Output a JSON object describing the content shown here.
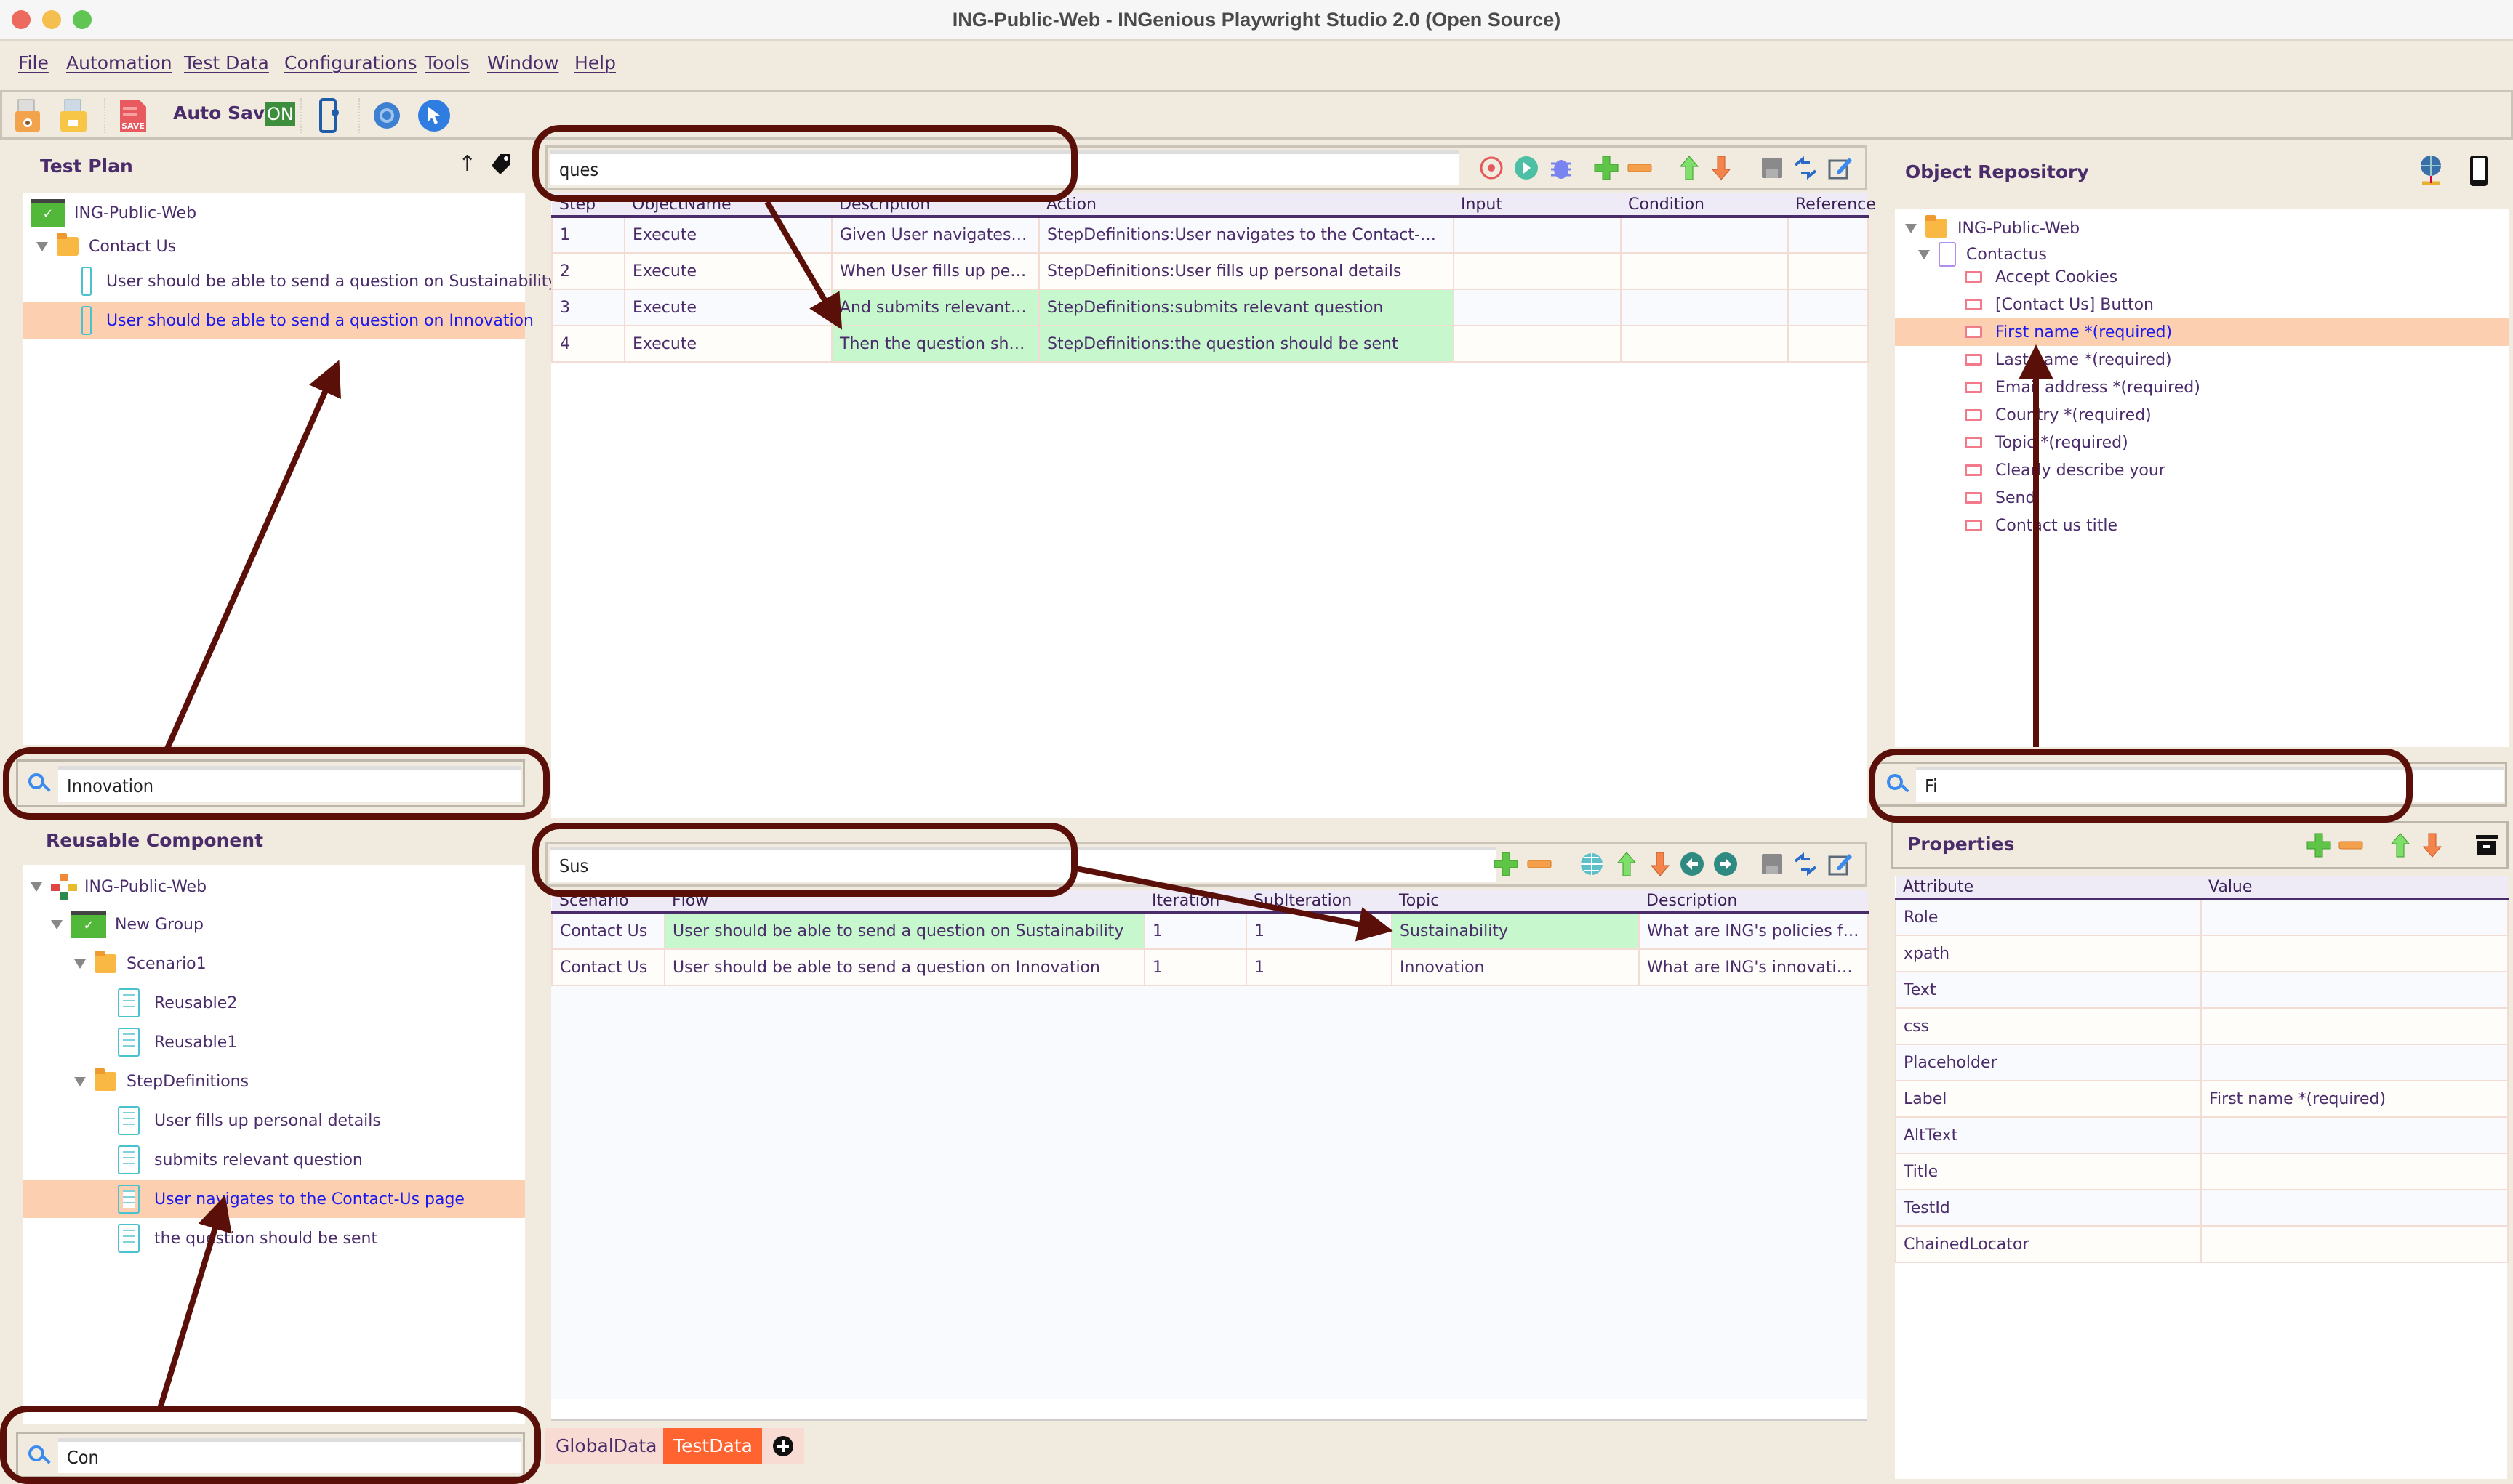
{
  "window": {
    "title": "ING-Public-Web - INGenious Playwright Studio 2.0 (Open Source)"
  },
  "menu": [
    "File",
    "Automation",
    "Test Data",
    "Configurations",
    "Tools",
    "Window",
    "Help"
  ],
  "toolbar": {
    "auto_save_label": "Auto Save",
    "auto_save_state": "ON"
  },
  "test_plan": {
    "title": "Test Plan",
    "tree": {
      "root": "ING-Public-Web",
      "folder": "Contact Us",
      "items": [
        {
          "label": "User should be able to send a question on Sustainability",
          "selected": false
        },
        {
          "label": "User should be able to send a question on Innovation",
          "selected": true
        }
      ]
    },
    "search_value": "Innovation"
  },
  "reusable": {
    "title": "Reusable Component",
    "root": "ING-Public-Web",
    "group": "New Group",
    "scenario1": {
      "label": "Scenario1",
      "items": [
        "Reusable2",
        "Reusable1"
      ]
    },
    "stepdefs": {
      "label": "StepDefinitions",
      "items": [
        "User fills up personal details",
        "submits relevant question",
        "User navigates to the Contact-Us page",
        "the question should be sent"
      ],
      "selected_index": 2
    },
    "search_value": "Con"
  },
  "test_case": {
    "search_value": "ques",
    "columns": [
      "Step",
      "ObjectName",
      "Description",
      "Action",
      "Input",
      "Condition",
      "Reference"
    ],
    "rows": [
      {
        "step": "1",
        "object": "Execute",
        "description": "Given  User navigates to...",
        "action": "StepDefinitions:User navigates to the Contact-Us page",
        "input": "",
        "condition": "",
        "reference": "",
        "highlight": false
      },
      {
        "step": "2",
        "object": "Execute",
        "description": "When  User fills up pers...",
        "action": "StepDefinitions:User fills up personal details",
        "input": "",
        "condition": "",
        "reference": "",
        "highlight": false
      },
      {
        "step": "3",
        "object": "Execute",
        "description": "And  submits relevant qu...",
        "action": "StepDefinitions:submits relevant question",
        "input": "",
        "condition": "",
        "reference": "",
        "highlight": true
      },
      {
        "step": "4",
        "object": "Execute",
        "description": "Then  the question shoul...",
        "action": "StepDefinitions:the question should be sent",
        "input": "",
        "condition": "",
        "reference": "",
        "highlight": true
      }
    ]
  },
  "test_data": {
    "search_value": "Sus",
    "columns": [
      "Scenario",
      "Flow",
      "Iteration",
      "SubIteration",
      "Topic",
      "Description"
    ],
    "rows": [
      {
        "scenario": "Contact Us",
        "flow": "User should be able to send a question on Sustainability",
        "iteration": "1",
        "subiteration": "1",
        "topic": "Sustainability",
        "description": "What are ING's policies for a g..",
        "highlight": true
      },
      {
        "scenario": "Contact Us",
        "flow": "User should be able to send a question on Innovation",
        "iteration": "1",
        "subiteration": "1",
        "topic": "Innovation",
        "description": "What are ING's innovation pol..",
        "highlight": false
      }
    ],
    "tabs": [
      {
        "label": "GlobalData",
        "active": false
      },
      {
        "label": "TestData",
        "active": true
      }
    ]
  },
  "object_repository": {
    "title": "Object Repository",
    "root": "ING-Public-Web",
    "page": "Contactus",
    "objects": [
      "Accept Cookies",
      "[Contact Us] Button",
      "First name *(required)",
      "Last name *(required)",
      "Email address *(required)",
      "Country *(required)",
      "Topic *(required)",
      "Clearly describe your",
      "Send",
      "Contact us title"
    ],
    "selected_index": 2,
    "search_value": "Fi"
  },
  "properties": {
    "title": "Properties",
    "columns": [
      "Attribute",
      "Value"
    ],
    "rows": [
      {
        "attribute": "Role",
        "value": ""
      },
      {
        "attribute": "xpath",
        "value": ""
      },
      {
        "attribute": "Text",
        "value": ""
      },
      {
        "attribute": "css",
        "value": ""
      },
      {
        "attribute": "Placeholder",
        "value": ""
      },
      {
        "attribute": "Label",
        "value": "First name *(required)"
      },
      {
        "attribute": "AltText",
        "value": ""
      },
      {
        "attribute": "Title",
        "value": ""
      },
      {
        "attribute": "TestId",
        "value": ""
      },
      {
        "attribute": "ChainedLocator",
        "value": ""
      }
    ]
  },
  "colors": {
    "accent": "#ff6330",
    "selection": "#fbcfb0",
    "highlight": "#c7f7cd",
    "text": "#4a2c6a",
    "annotation": "#5a1009"
  }
}
